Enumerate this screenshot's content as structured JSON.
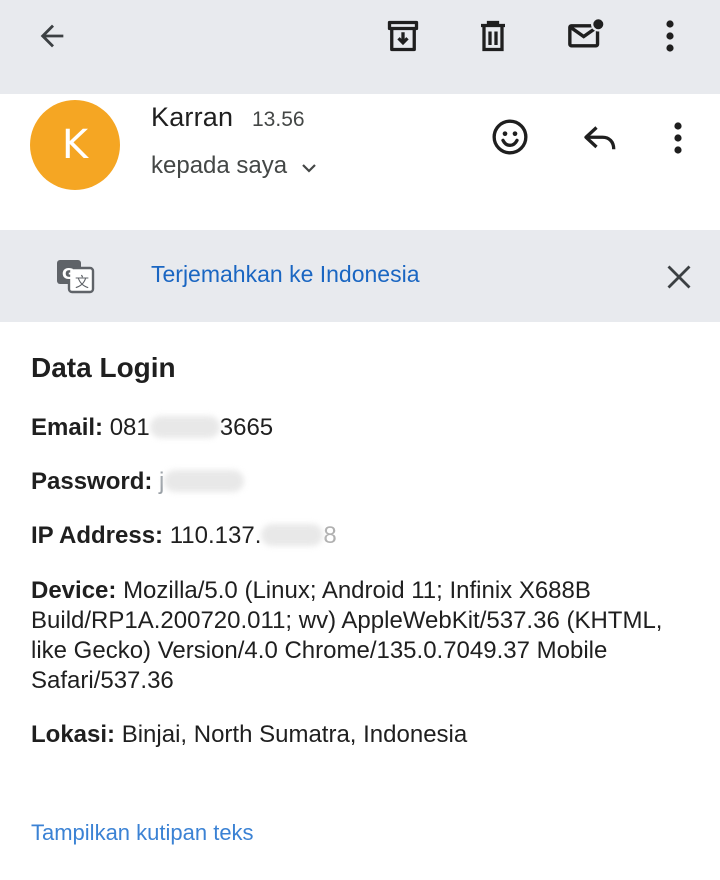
{
  "toolbar": {
    "back_icon": "arrow-left-icon",
    "archive_icon": "archive-icon",
    "delete_icon": "trash-icon",
    "mark_unread_icon": "mail-unread-icon",
    "more_icon": "more-vert-icon"
  },
  "message": {
    "avatar_letter": "K",
    "avatar_color": "#f5a623",
    "sender": "Karran",
    "time": "13.56",
    "recipient": "kepada saya",
    "react_icon": "emoji-icon",
    "reply_icon": "reply-icon",
    "more_icon": "more-vert-icon"
  },
  "translate": {
    "icon": "translate-icon",
    "link": "Terjemahkan ke Indonesia",
    "close_icon": "close-icon"
  },
  "body": {
    "heading": "Data Login",
    "email_label": "Email:",
    "email_prefix": "081",
    "email_suffix": "3665",
    "password_label": "Password:",
    "password_prefix": "j",
    "ip_label": "IP Address:",
    "ip_prefix": "110.137.",
    "ip_suffix": "8",
    "device_label": "Device:",
    "device_value": "Mozilla/5.0 (Linux; Android 11; Infinix X688B Build/RP1A.200720.011; wv) AppleWebKit/537.36 (KHTML, like Gecko) Version/4.0 Chrome/135.0.7049.37 Mobile Safari/537.36",
    "location_label": "Lokasi:",
    "location_value": "Binjai, North Sumatra, Indonesia"
  },
  "footer": {
    "show_quoted": "Tampilkan kutipan teks"
  }
}
